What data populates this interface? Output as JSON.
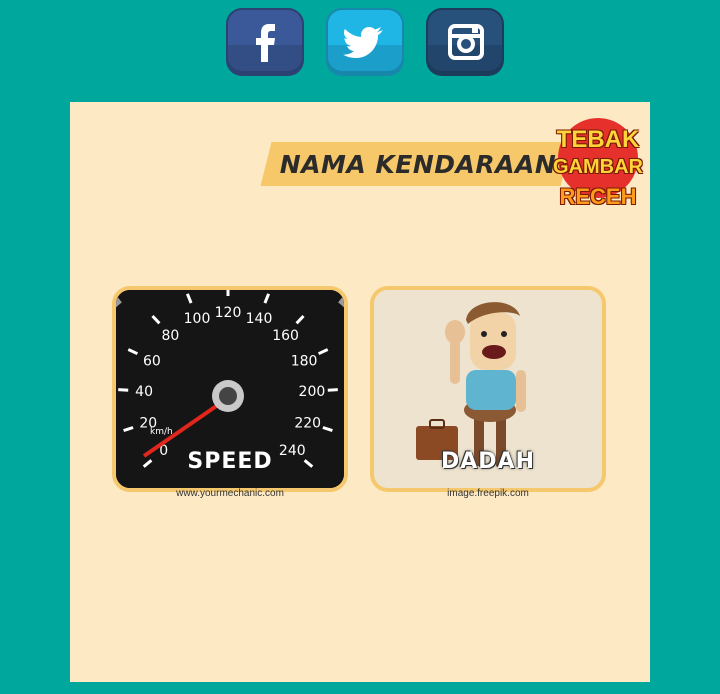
{
  "share": [
    {
      "name": "facebook",
      "icon": "facebook-icon",
      "color": "#3b5998"
    },
    {
      "name": "twitter",
      "icon": "twitter-icon",
      "color": "#1fb6e6"
    },
    {
      "name": "instagram",
      "icon": "instagram-icon",
      "color": "#27507a"
    }
  ],
  "card": {
    "title": "NAMA KENDARAAN",
    "logo": {
      "line1": "TEBAK",
      "line2": "GAMBAR",
      "line3": "RECEH"
    },
    "clues": [
      {
        "word": "SPEED",
        "credit": "www.yourmechanic.com",
        "image": "speedometer",
        "dial_labels": [
          "0",
          "20",
          "40",
          "60",
          "80",
          "100",
          "120",
          "140",
          "160",
          "180",
          "200",
          "220",
          "240"
        ],
        "unit": "km/h"
      },
      {
        "word": "DADAH",
        "credit": "image.freepik.com",
        "image": "waving-man-with-suitcase"
      }
    ]
  },
  "colors": {
    "background": "#00a79d",
    "card": "#fde9c4",
    "tile_border": "#f6c86d",
    "banner": "#f7c86a"
  }
}
